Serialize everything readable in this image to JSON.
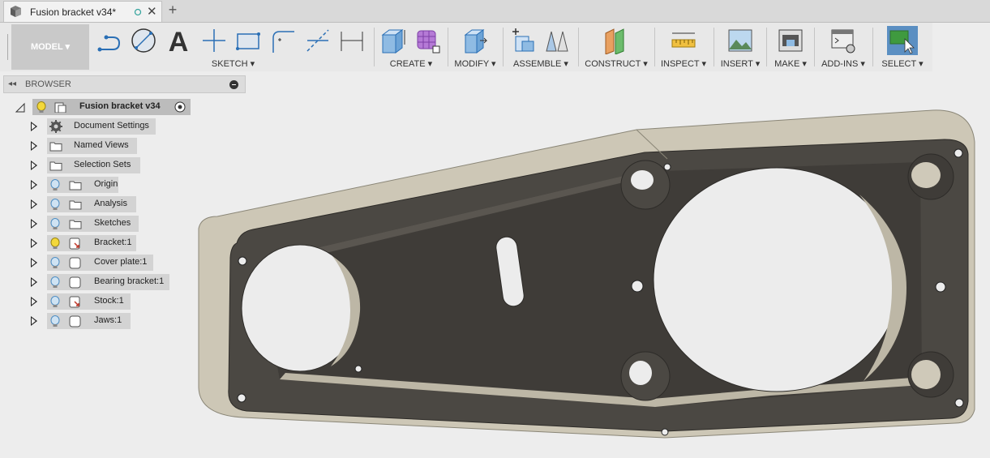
{
  "document_tab": {
    "title": "Fusion bracket v34*",
    "unsaved_icon": "unsaved-dot-icon",
    "close_label": "✕",
    "new_tab_label": "+"
  },
  "toolbar": {
    "workspace": "MODEL",
    "groups": [
      {
        "label": "SKETCH"
      },
      {
        "label": "CREATE"
      },
      {
        "label": "MODIFY"
      },
      {
        "label": "ASSEMBLE"
      },
      {
        "label": "CONSTRUCT"
      },
      {
        "label": "INSPECT"
      },
      {
        "label": "INSERT"
      },
      {
        "label": "MAKE"
      },
      {
        "label": "ADD-INS"
      },
      {
        "label": "SELECT"
      }
    ],
    "dropdown_arrow": "▾"
  },
  "browser": {
    "title": "BROWSER",
    "collapse_glyph": "◂◂",
    "root": {
      "label": "Fusion bracket v34"
    },
    "items": [
      {
        "label": "Document Settings",
        "icon": "gear-icon"
      },
      {
        "label": "Named Views",
        "icon": "folder-icon"
      },
      {
        "label": "Selection Sets",
        "icon": "folder-icon"
      },
      {
        "label": "Origin",
        "icon": "folder-icon",
        "visible": true
      },
      {
        "label": "Analysis",
        "icon": "folder-icon",
        "visible": true
      },
      {
        "label": "Sketches",
        "icon": "folder-icon",
        "visible": true
      },
      {
        "label": "Bracket:1",
        "icon": "component-icon",
        "visible": true,
        "active": true
      },
      {
        "label": "Cover plate:1",
        "icon": "component-icon",
        "visible": true
      },
      {
        "label": "Bearing bracket:1",
        "icon": "component-icon",
        "visible": true
      },
      {
        "label": "Stock:1",
        "icon": "component-icon",
        "visible": true
      },
      {
        "label": "Jaws:1",
        "icon": "component-icon",
        "visible": true
      }
    ]
  },
  "colors": {
    "accent": "#4a90c8",
    "part_dark": "#4b4843",
    "part_light": "#cfc9b9",
    "bulb_yellow": "#f3d83a",
    "bulb_blue": "#7fb6dc"
  }
}
